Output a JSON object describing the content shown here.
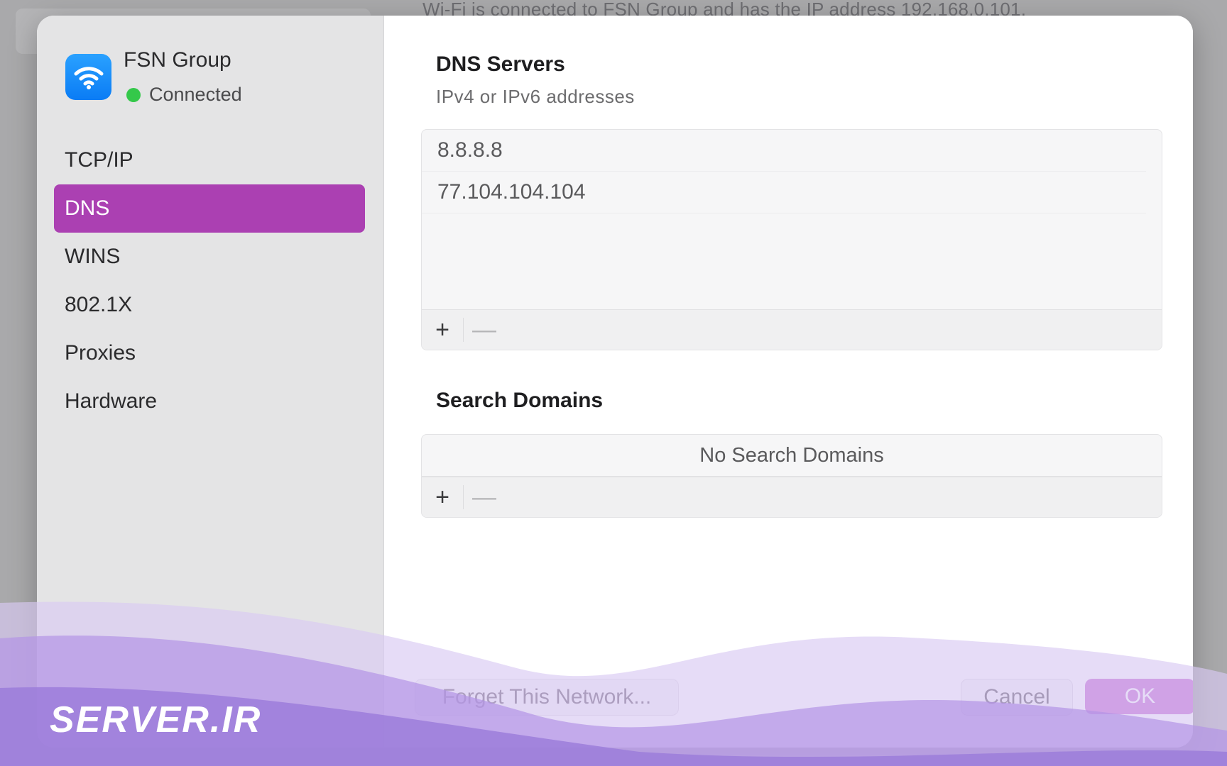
{
  "backdrop": {
    "status_text": "Wi-Fi is connected to FSN Group and has the IP address 192.168.0.101."
  },
  "sidebar": {
    "network_name": "FSN Group",
    "network_status": "Connected",
    "items": [
      {
        "label": "TCP/IP",
        "active": false
      },
      {
        "label": "DNS",
        "active": true
      },
      {
        "label": "WINS",
        "active": false
      },
      {
        "label": "802.1X",
        "active": false
      },
      {
        "label": "Proxies",
        "active": false
      },
      {
        "label": "Hardware",
        "active": false
      }
    ]
  },
  "dns": {
    "title": "DNS Servers",
    "subtitle": "IPv4 or IPv6 addresses",
    "servers": [
      "8.8.8.8",
      "77.104.104.104"
    ],
    "add_symbol": "+",
    "remove_symbol": "—"
  },
  "search_domains": {
    "title": "Search Domains",
    "empty_text": "No Search Domains",
    "add_symbol": "+",
    "remove_symbol": "—"
  },
  "footer": {
    "forget_label": "Forget This Network...",
    "cancel_label": "Cancel",
    "ok_label": "OK"
  },
  "watermark": {
    "logo_text": "SERVER.IR"
  },
  "colors": {
    "accent": "#ab40b2",
    "ok_button": "#c15bcf",
    "status_green": "#34c84a",
    "wifi_icon": "#0a7cf5"
  },
  "icons": {
    "network": "wifi-icon",
    "status": "status-dot-icon",
    "add": "plus-icon",
    "remove": "minus-icon"
  }
}
